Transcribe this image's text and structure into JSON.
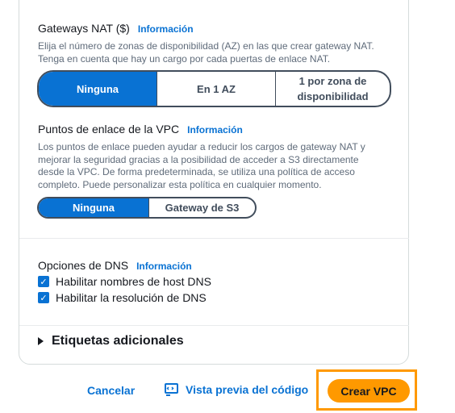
{
  "nat": {
    "title": "Gateways NAT ($)",
    "info": "Información",
    "desc_line1": "Elija el número de zonas de disponibilidad (AZ) en las que crear gateway NAT.",
    "desc_line2": "Tenga en cuenta que hay un cargo por cada puertas de enlace NAT.",
    "options": [
      "Ninguna",
      "En 1 AZ",
      "1 por zona de disponibilidad"
    ],
    "option3_line1": "1 por zona de",
    "option3_line2": "disponibilidad",
    "selected": "Ninguna"
  },
  "endpoints": {
    "title": "Puntos de enlace de la VPC",
    "info": "Información",
    "desc_line1": "Los puntos de enlace pueden ayudar a reducir los cargos de gateway NAT y",
    "desc_line2": "mejorar la seguridad gracias a la posibilidad de acceder a S3 directamente",
    "desc_line3": "desde la VPC. De forma predeterminada, se utiliza una política de acceso",
    "desc_line4": "completo. Puede personalizar esta política en cualquier momento.",
    "options": [
      "Ninguna",
      "Gateway de S3"
    ],
    "selected": "Ninguna"
  },
  "dns": {
    "title": "Opciones de DNS",
    "info": "Información",
    "checkboxes": [
      {
        "label": "Habilitar nombres de host DNS",
        "checked": true
      },
      {
        "label": "Habilitar la resolución de DNS",
        "checked": true
      }
    ]
  },
  "tags": {
    "label": "Etiquetas adicionales"
  },
  "footer": {
    "cancel": "Cancelar",
    "preview": "Vista previa del código",
    "create": "Crear VPC"
  },
  "colors": {
    "accent": "#0972d3",
    "primary": "#ff9900",
    "highlight_border": "#ff9900"
  },
  "icons": {
    "preview": "code-preview-icon",
    "checkbox": "checkmark-icon",
    "expander": "caret-right-icon"
  }
}
